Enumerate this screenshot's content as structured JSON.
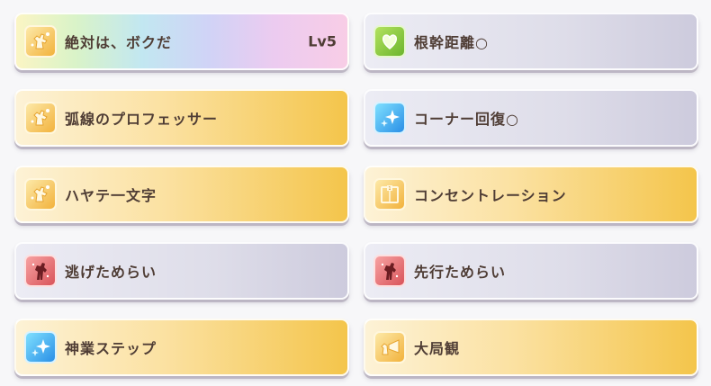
{
  "skills": [
    {
      "name": "絶対は、ボクだ",
      "level": "Lv5",
      "style": "rainbow",
      "icon": "trophy-horse-icon"
    },
    {
      "name": "根幹距離○",
      "level": "",
      "style": "normal",
      "icon": "heart-icon"
    },
    {
      "name": "弧線のプロフェッサー",
      "level": "",
      "style": "gold",
      "icon": "trophy-horse-icon"
    },
    {
      "name": "コーナー回復○",
      "level": "",
      "style": "normal",
      "icon": "sparkle-icon"
    },
    {
      "name": "ハヤテ一文字",
      "level": "",
      "style": "gold",
      "icon": "trophy-horse-icon"
    },
    {
      "name": "コンセントレーション",
      "level": "",
      "style": "gold",
      "icon": "gate-icon"
    },
    {
      "name": "逃げためらい",
      "level": "",
      "style": "normal",
      "icon": "horse-silhouette-icon"
    },
    {
      "name": "先行ためらい",
      "level": "",
      "style": "normal",
      "icon": "horse-silhouette-icon"
    },
    {
      "name": "神業ステップ",
      "level": "",
      "style": "gold",
      "icon": "sparkle-icon"
    },
    {
      "name": "大局観",
      "level": "",
      "style": "gold",
      "icon": "megaphone-horse-icon"
    }
  ]
}
